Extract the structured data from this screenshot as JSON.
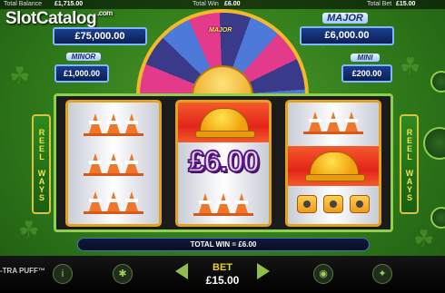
{
  "topbar": {
    "balance_label": "Total Balance",
    "balance_value": "£1,715.00",
    "win_label": "Total Win",
    "win_value": "£6.00",
    "bet_label": "Total Bet",
    "bet_value": "£15.00"
  },
  "brand": {
    "name": "SlotCatalog",
    "suffix": ".com"
  },
  "jackpots": {
    "grand_value": "£75,000.00",
    "major_label": "MAJOR",
    "major_value": "£6,000.00",
    "minor_label": "MINOR",
    "minor_value": "£1,000.00",
    "mini_label": "MINI",
    "mini_value": "£200.00"
  },
  "wheel": {
    "segment_label": "MAJOR"
  },
  "reels": {
    "prize": "£6.00",
    "reel_ways_left": "REEL WAYS",
    "reel_ways_right": "REEL WAYS"
  },
  "total_win": "TOTAL WIN = £6.00",
  "bottom": {
    "game_name": "-TRA PUFF™",
    "bet_label": "BET",
    "bet_value": "£15.00"
  },
  "colors": {
    "background": "#2f7a1a",
    "reel_frame": "#e2a21e",
    "jackpot_panel": "#1b3e8c",
    "bet_label": "#e6d230"
  }
}
